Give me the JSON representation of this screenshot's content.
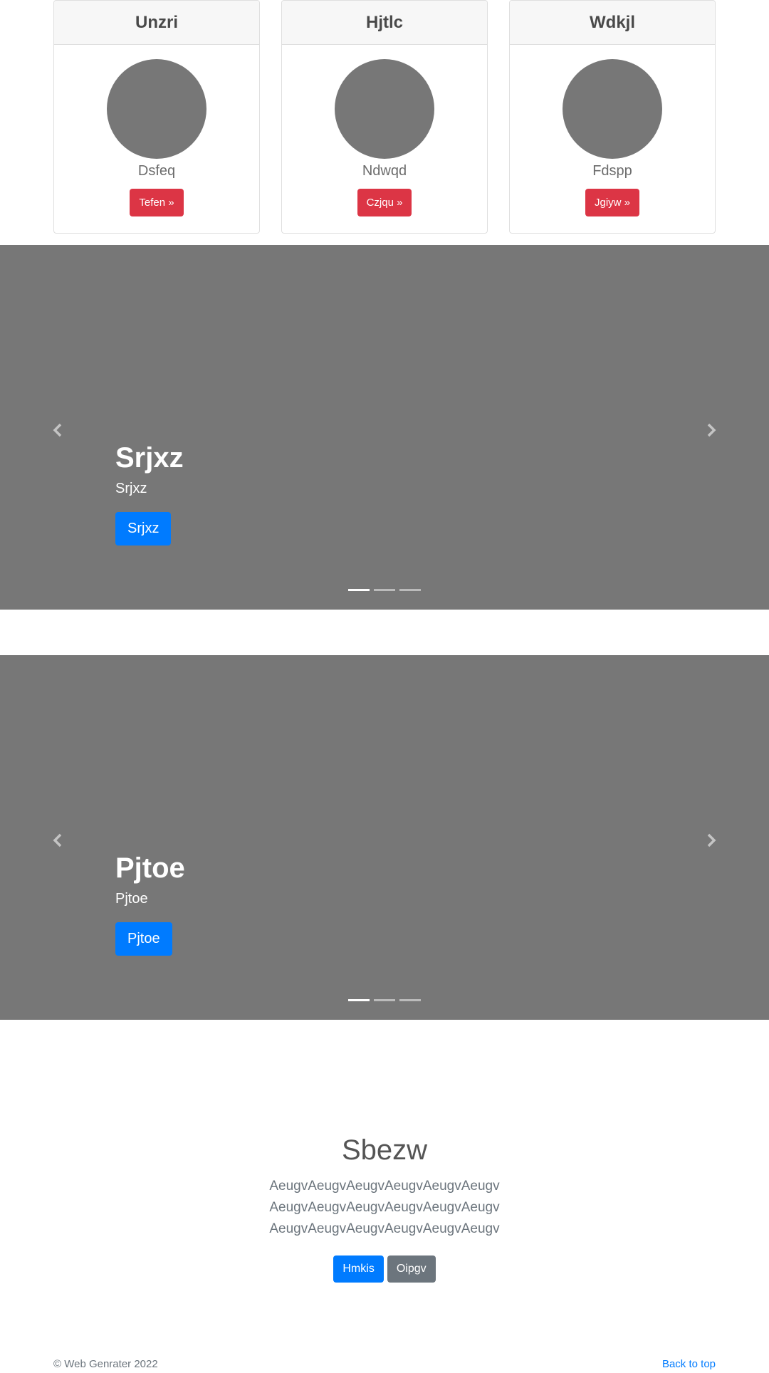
{
  "cards": [
    {
      "title": "Unzri",
      "name": "Dsfeq",
      "button": "Tefen »"
    },
    {
      "title": "Hjtlc",
      "name": "Ndwqd",
      "button": "Czjqu »"
    },
    {
      "title": "Wdkjl",
      "name": "Fdspp",
      "button": "Jgiyw »"
    }
  ],
  "carousels": [
    {
      "title": "Srjxz",
      "text": "Srjxz",
      "button": "Srjxz",
      "indicators": 3,
      "active_slide": 1
    },
    {
      "title": "Pjtoe",
      "text": "Pjtoe",
      "button": "Pjtoe",
      "indicators": 3,
      "active_slide": 1
    }
  ],
  "jumbotron": {
    "title": "Sbezw",
    "lines": [
      "AeugvAeugvAeugvAeugvAeugvAeugv",
      "AeugvAeugvAeugvAeugvAeugvAeugv",
      "AeugvAeugvAeugvAeugvAeugvAeugv"
    ],
    "primary_button": "Hmkis",
    "secondary_button": "Oipgv"
  },
  "footer": {
    "copyright": "© Web Genrater 2022",
    "back_to_top": "Back to top"
  },
  "icons": {
    "prev": "chevron-left-icon",
    "next": "chevron-right-icon"
  },
  "colors": {
    "primary": "#007bff",
    "danger": "#dc3545",
    "secondary": "#6c757d",
    "placeholder": "#777777"
  }
}
